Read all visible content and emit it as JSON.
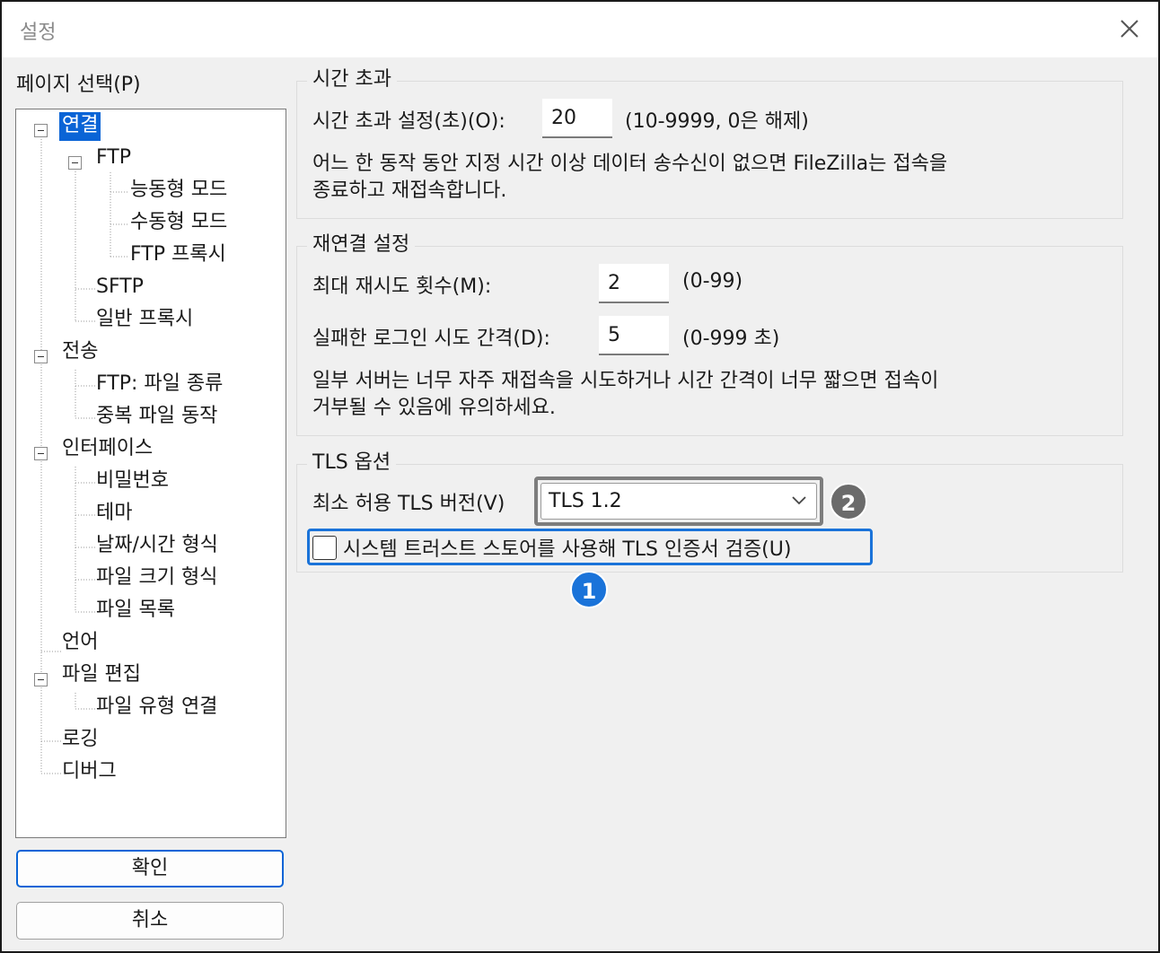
{
  "window": {
    "title": "설정"
  },
  "page_select": {
    "label": "페이지 선택(P)"
  },
  "tree": {
    "items": [
      {
        "label": "연결",
        "selected": true
      },
      {
        "label": "FTP"
      },
      {
        "label": "능동형 모드"
      },
      {
        "label": "수동형 모드"
      },
      {
        "label": "FTP 프록시"
      },
      {
        "label": "SFTP"
      },
      {
        "label": "일반 프록시"
      },
      {
        "label": "전송"
      },
      {
        "label": "FTP: 파일 종류"
      },
      {
        "label": "중복 파일 동작"
      },
      {
        "label": "인터페이스"
      },
      {
        "label": "비밀번호"
      },
      {
        "label": "테마"
      },
      {
        "label": "날짜/시간 형식"
      },
      {
        "label": "파일 크기 형식"
      },
      {
        "label": "파일 목록"
      },
      {
        "label": "언어"
      },
      {
        "label": "파일 편집"
      },
      {
        "label": "파일 유형 연결"
      },
      {
        "label": "로깅"
      },
      {
        "label": "디버그"
      }
    ]
  },
  "buttons": {
    "ok": "확인",
    "cancel": "취소"
  },
  "timeout": {
    "legend": "시간 초과",
    "label": "시간 초과 설정(초)(O):",
    "value": "20",
    "range": "(10-9999, 0은 해제)",
    "desc_line1": "어느 한 동작 동안 지정 시간 이상 데이터 송수신이 없으면 FileZilla는 접속을",
    "desc_line2": "종료하고 재접속합니다."
  },
  "reconnect": {
    "legend": "재연결 설정",
    "retries_label": "최대 재시도 횟수(M):",
    "retries_value": "2",
    "retries_range": "(0-99)",
    "delay_label": "실패한 로그인 시도 간격(D):",
    "delay_value": "5",
    "delay_range": "(0-999 초)",
    "desc_line1": "일부 서버는 너무 자주 재접속을 시도하거나 시간 간격이 너무 짧으면 접속이",
    "desc_line2": "거부될 수 있음에 유의하세요."
  },
  "tls": {
    "legend": "TLS 옵션",
    "min_version_label": "최소 허용 TLS 버전(V)",
    "min_version_value": "TLS 1.2",
    "trust_store_label": "시스템 트러스트 스토어를 사용해 TLS 인증서 검증(U)",
    "trust_store_checked": false
  },
  "badges": {
    "one": "1",
    "two": "2"
  },
  "colors": {
    "accent": "#0a64d6",
    "highlight_blue": "#1a73d9",
    "highlight_gray": "#7d7d7d",
    "badge_blue": "#1a73d9",
    "badge_gray": "#6b6b6b"
  }
}
